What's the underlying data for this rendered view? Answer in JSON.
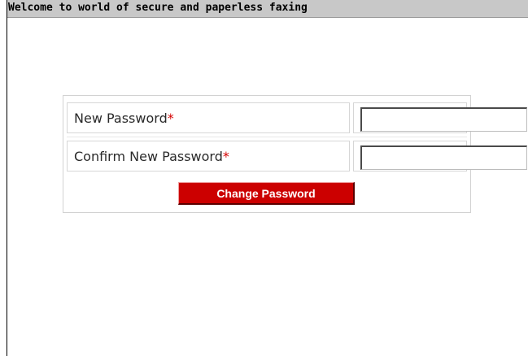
{
  "header": {
    "title": "Welcome to world of secure and paperless faxing"
  },
  "form": {
    "new_password_label": "New Password",
    "confirm_password_label": "Confirm New Password",
    "required_marker": "*",
    "new_password_value": "",
    "confirm_password_value": "",
    "submit_label": "Change Password"
  },
  "colors": {
    "header_bg": "#c8c8c8",
    "button_bg": "#cc0000",
    "required": "#d40000"
  }
}
